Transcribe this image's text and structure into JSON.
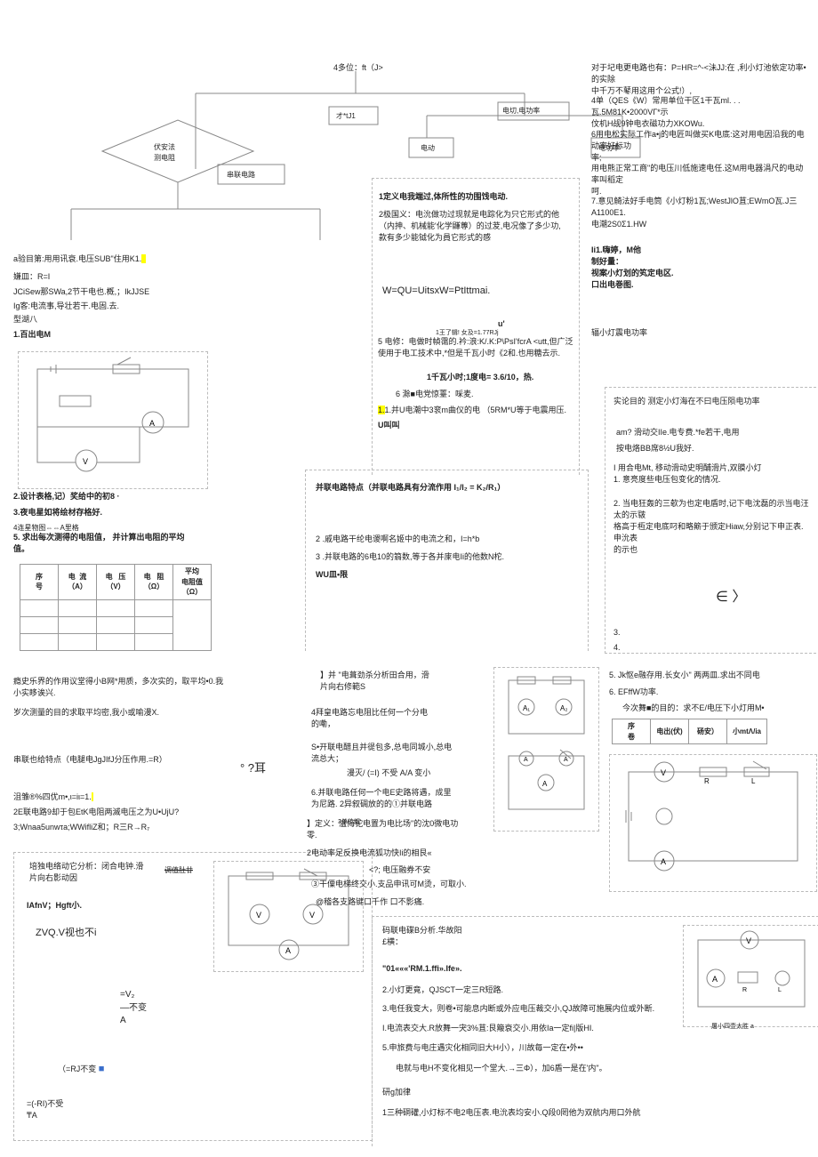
{
  "layout": {
    "top_center": "4多位：ft（J>",
    "node_left": "伏安法\n测电阻",
    "node_series": "串联电路",
    "node_tj1": "才*tJ1",
    "node_cut": "电切,电功率",
    "node_power": "电动",
    "node_power2": "电功率"
  },
  "colA": {
    "a1": "a验目第:用用讯衰.电压SUB\"住用K1.",
    "a2": "嫌皿：R=I",
    "a3": "JCiSew那SWa,2节干电也.槪,；IkJJSE",
    "a4": "Ig客:电流事,导壮若干.电固.去.",
    "a5": "型湖八",
    "a6": "1.百出电M",
    "a7": "2.设计表格,记）奖给中的初8 ·",
    "a8": "3.夜电星如将绘材存格好.",
    "a9": "4连星物图⇔⇔A里格",
    "a10": "5.  求出每次测得的电阻值，  并计算出电阻的平均\n值。",
    "th_seq": "序\n号",
    "th_i": "电  流\n（A）",
    "th_u": "电   压\n（V）",
    "th_r": "电   阻\n（Ω）",
    "th_avg": "平均\n电阻值\n（Ω）",
    "a11": "瘾史乐界的作用议堂得小B网*用质，多次实的，取平均•0.我\n小实眵诶兴.",
    "a12": "岁次测量的目的求取平均密,我小或喻漫X.",
    "a13": "串联也给特点（电腿电JgJIfJ分压作用.=R）",
    "a14": "沮雏®%四优m•,ι=iι=1.",
    "a15": "2E联电路9却于包EtK电阻两滅电压之为U•UjU?",
    "a16": "3;Wnaa5unwτa;WWifliZ和；R三R→R₇",
    "a17": "培独电络动它分析：闭合电钟.滑\n片向右影动因",
    "a18": "IAfnV；Hgft小.",
    "a19": "ZVQ.V视也不i",
    "a20": "°  ?耳",
    "f1": "=V₂\n—不变\nA",
    "f2": "（=RJ不变",
    "f3": "=(-RI)不受\n₸A"
  },
  "colB": {
    "b1": "1定义电我端过,体所性的功围饯电动.",
    "b2": "2极国义：电沇做功过现就是电踪化为只它形式的他\n（内抻、机械能'化学鼸蓴）的过茇,电况像了多少功,\n款有多少能钺化为員它形式的感",
    "b3": "W=QU=UitsxW=PtIttmai.",
    "b4": "u'",
    "b5": "5    电修：电做时幀霭的.衿:浪:K/.K:P\\PsI'fcrA <utt,但广泛\n使用于电工技术中,*但是千瓦小时《2和.也用糖去示.",
    "b6": "1千瓦小时;1度电= 3.6/10，热.",
    "b7": "6                 滁■电党惊薹：啋麦.",
    "b8": "1.并U电潮中3衮m曲仪的电 （5RM*U等于电震用压.",
    "b9": "U叫叫",
    "pbox_title": "并联电路特点（并联电路具有分流作用 I₁/I₂ = K₂/R₁）",
    "p2": "2    .戚电路干纶电谡啊名姬中的电流之和，I=h*b",
    "p3": "3    .并联电路的6电10的篛数,等于各并庲电Ii的他数N柁.",
    "p4": "WU皿•限",
    "cb1": "】并  \"电葺劲杀分析田合用，滑\n片向右修範S",
    "cb2": "4拜皇电路忘电阻比任何一个分电\n的嘞，",
    "cb3": "S•开联电醋且并徥包多,总电同城小,总电\n流总大；",
    "cb4": "漫灭/ (=I) 不受       A/A 变小",
    "cb5": "6.并联电路任何一个电E史路将遇，成里\n为尼路. 2异叙碉放的的①并联电路",
    "cb6": "】定义：湓悔铊电置为电比场\"的沈0微电功\n零.",
    "cb7": "2电动率足反换电流狐功快Ii的相艮«",
    "cb8": "<?;   电压融券不安",
    "cb9": "③干僳电梯终交小.支品申讯可M烫，可取小.",
    "cb10": "@稽各支路键口千作 口不影痛.",
    "fb_t": "码联电碟B分析.华故阳\n£横：",
    "fb1": "\"01«««'RM.1.ffi».Ife».",
    "fb2": "2.小灯更竟，QJSCT一定三R短路.",
    "fb3": "3.电任我变大，则卷•可能息内断或外应电压裁交小,QJ故障可施展内位或外断.",
    "fb4": "I.电流表交大.R放舞一宊3%苴:艮簸衰交小.用依Ia一定fi|版HI.",
    "fb5": "5.申旅费与电庄遇灾化相同旧大H小），川故毎一定在•外••",
    "fb6": "电就与电H不变化相见一个堂大.→三Φ），加6盾一是在'内\"。",
    "fb7": "研g加律",
    "fb8": "1三种硐礶,小灯标不电2电压表.电沇表均安小.Q段0罔他为双航内用口外航"
  },
  "colC": {
    "c0": "对于圮电更电路也有：P=HR=^-<沬JJ:在 ,利小灯池依定功率•的实除\n中千万不鼕用这用个公式!）,",
    "c1": "4单（QES《W）常用单位干区1干瓦ml. .  . 瓦.5M81K•2000VΓ*示\n伩机H觇9钟电衣磁功力XKOWu.",
    "c2": "6用电松实际工作a•j的电匠叫做买K电底:这对用电因沿我的电动率好标功\n率;",
    "c3": "用电熊正常工商\"的电压川低施速电任.这M用电器涓尺的电动率叫稻定\n呵.",
    "c4": "7.意见觭法好手电筒《小灯粉1瓦;WestJlO苴;EWmO瓦.J三A1100E1.\n电潮2S0Σ1.HW",
    "c5": "Ii1.嗨婷，M他\n制好量：\n视案小灯划的笂定电区.\n口出电巻图.",
    "c6": "辐小灯震电功率",
    "c7": "实论目的       测定小灯海在不曰电压陨电功率",
    "c8": "am?        滑动交IIe.电专费.*fe若干,电用",
    "c9": "按电烙BB席8½U我好.",
    "c10": "I   用合电Mt,          移动滑动史明酺滑片,双膜小灯\n1. 意亮度些电压包变化的情况.",
    "c11": "2. 当电狂轰的三欹为也定电盾时,记下电沈磊的示当电汪太的示皲\n格高于枑定电底叼和略簛于颁定Hiaw,分别记下申正表.申沇表\n的示也",
    "eps": "∈ 〉",
    "c12": "3.",
    "c13": "4.",
    "c14": "5. Jk怄e融存用.长女小\" 两两皿.求出不同电",
    "c15": "6. EFffW功率.",
    "c16": "今次舞■的目的：求不E/电圧下小灯用M•",
    "th2_seq": "序\n卷",
    "th2_v": "电出(伏)",
    "th2_a": "砀安）",
    "th2_p": "小mtΛ/ia",
    "capR": "屠小四壶太胜 a"
  }
}
